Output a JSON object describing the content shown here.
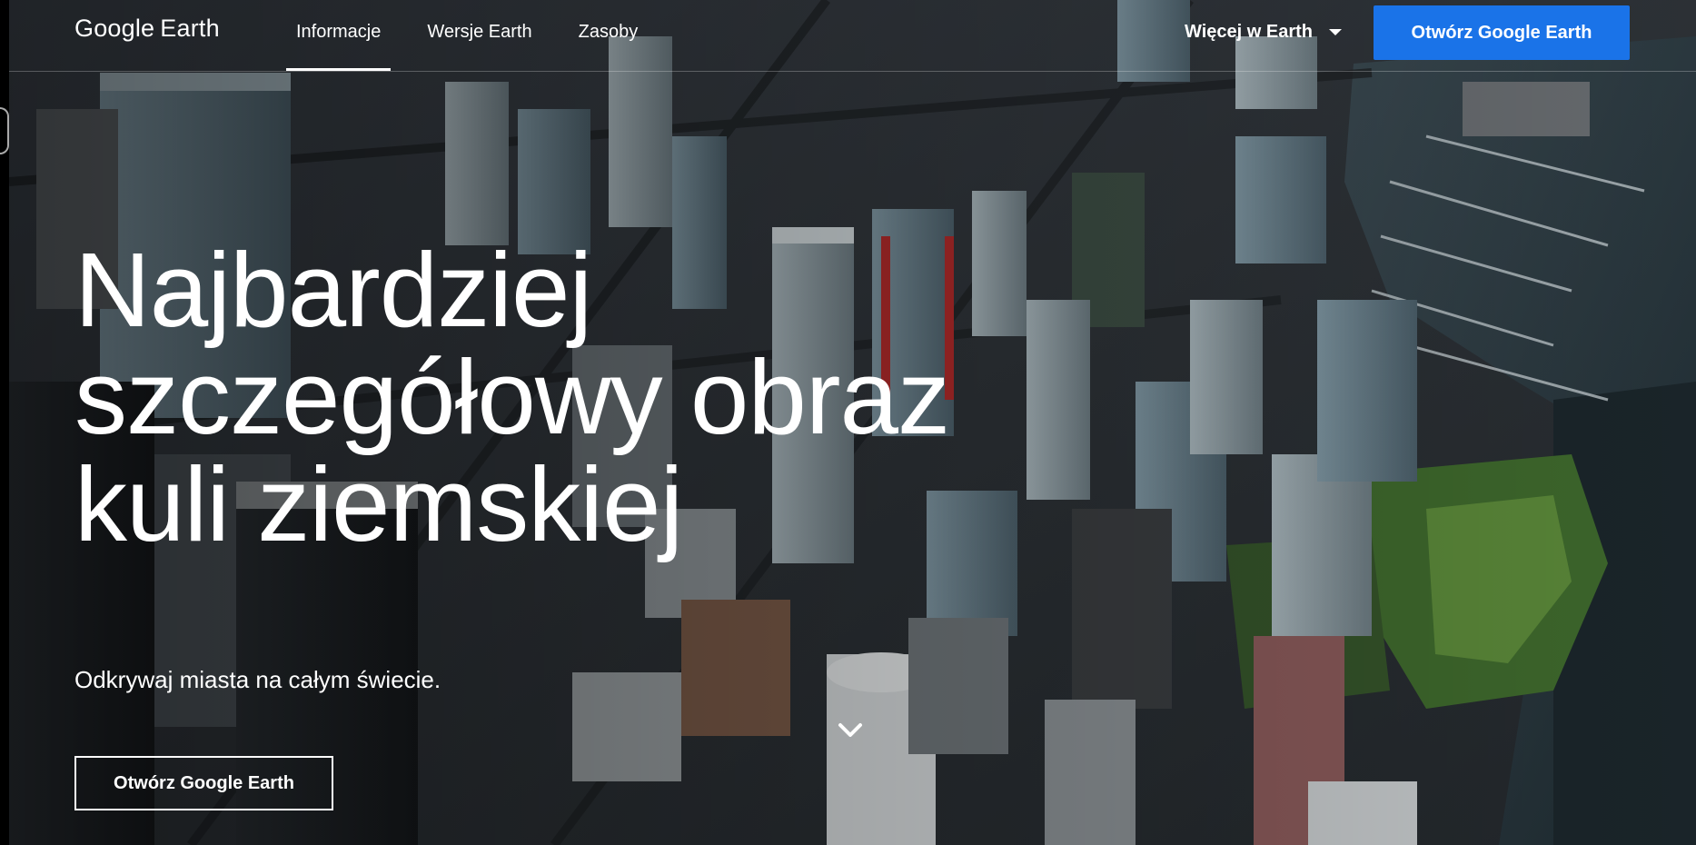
{
  "header": {
    "logo": {
      "brand": "Google",
      "product": "Earth"
    },
    "nav": [
      {
        "label": "Informacje",
        "active": true
      },
      {
        "label": "Wersje Earth",
        "active": false
      },
      {
        "label": "Zasoby",
        "active": false
      }
    ],
    "more_label": "Więcej w Earth",
    "cta_label": "Otwórz Google Earth"
  },
  "hero": {
    "title_lines": [
      "Najbardziej",
      "szczegółowy obraz",
      "kuli ziemskiej"
    ],
    "subtitle": "Odkrywaj miasta na całym świecie.",
    "cta_label": "Otwórz Google Earth"
  },
  "icons": {
    "more_dropdown": "chevron-down-icon",
    "scroll": "chevron-down-icon"
  },
  "colors": {
    "accent": "#1a73e8",
    "text": "#ffffff"
  }
}
